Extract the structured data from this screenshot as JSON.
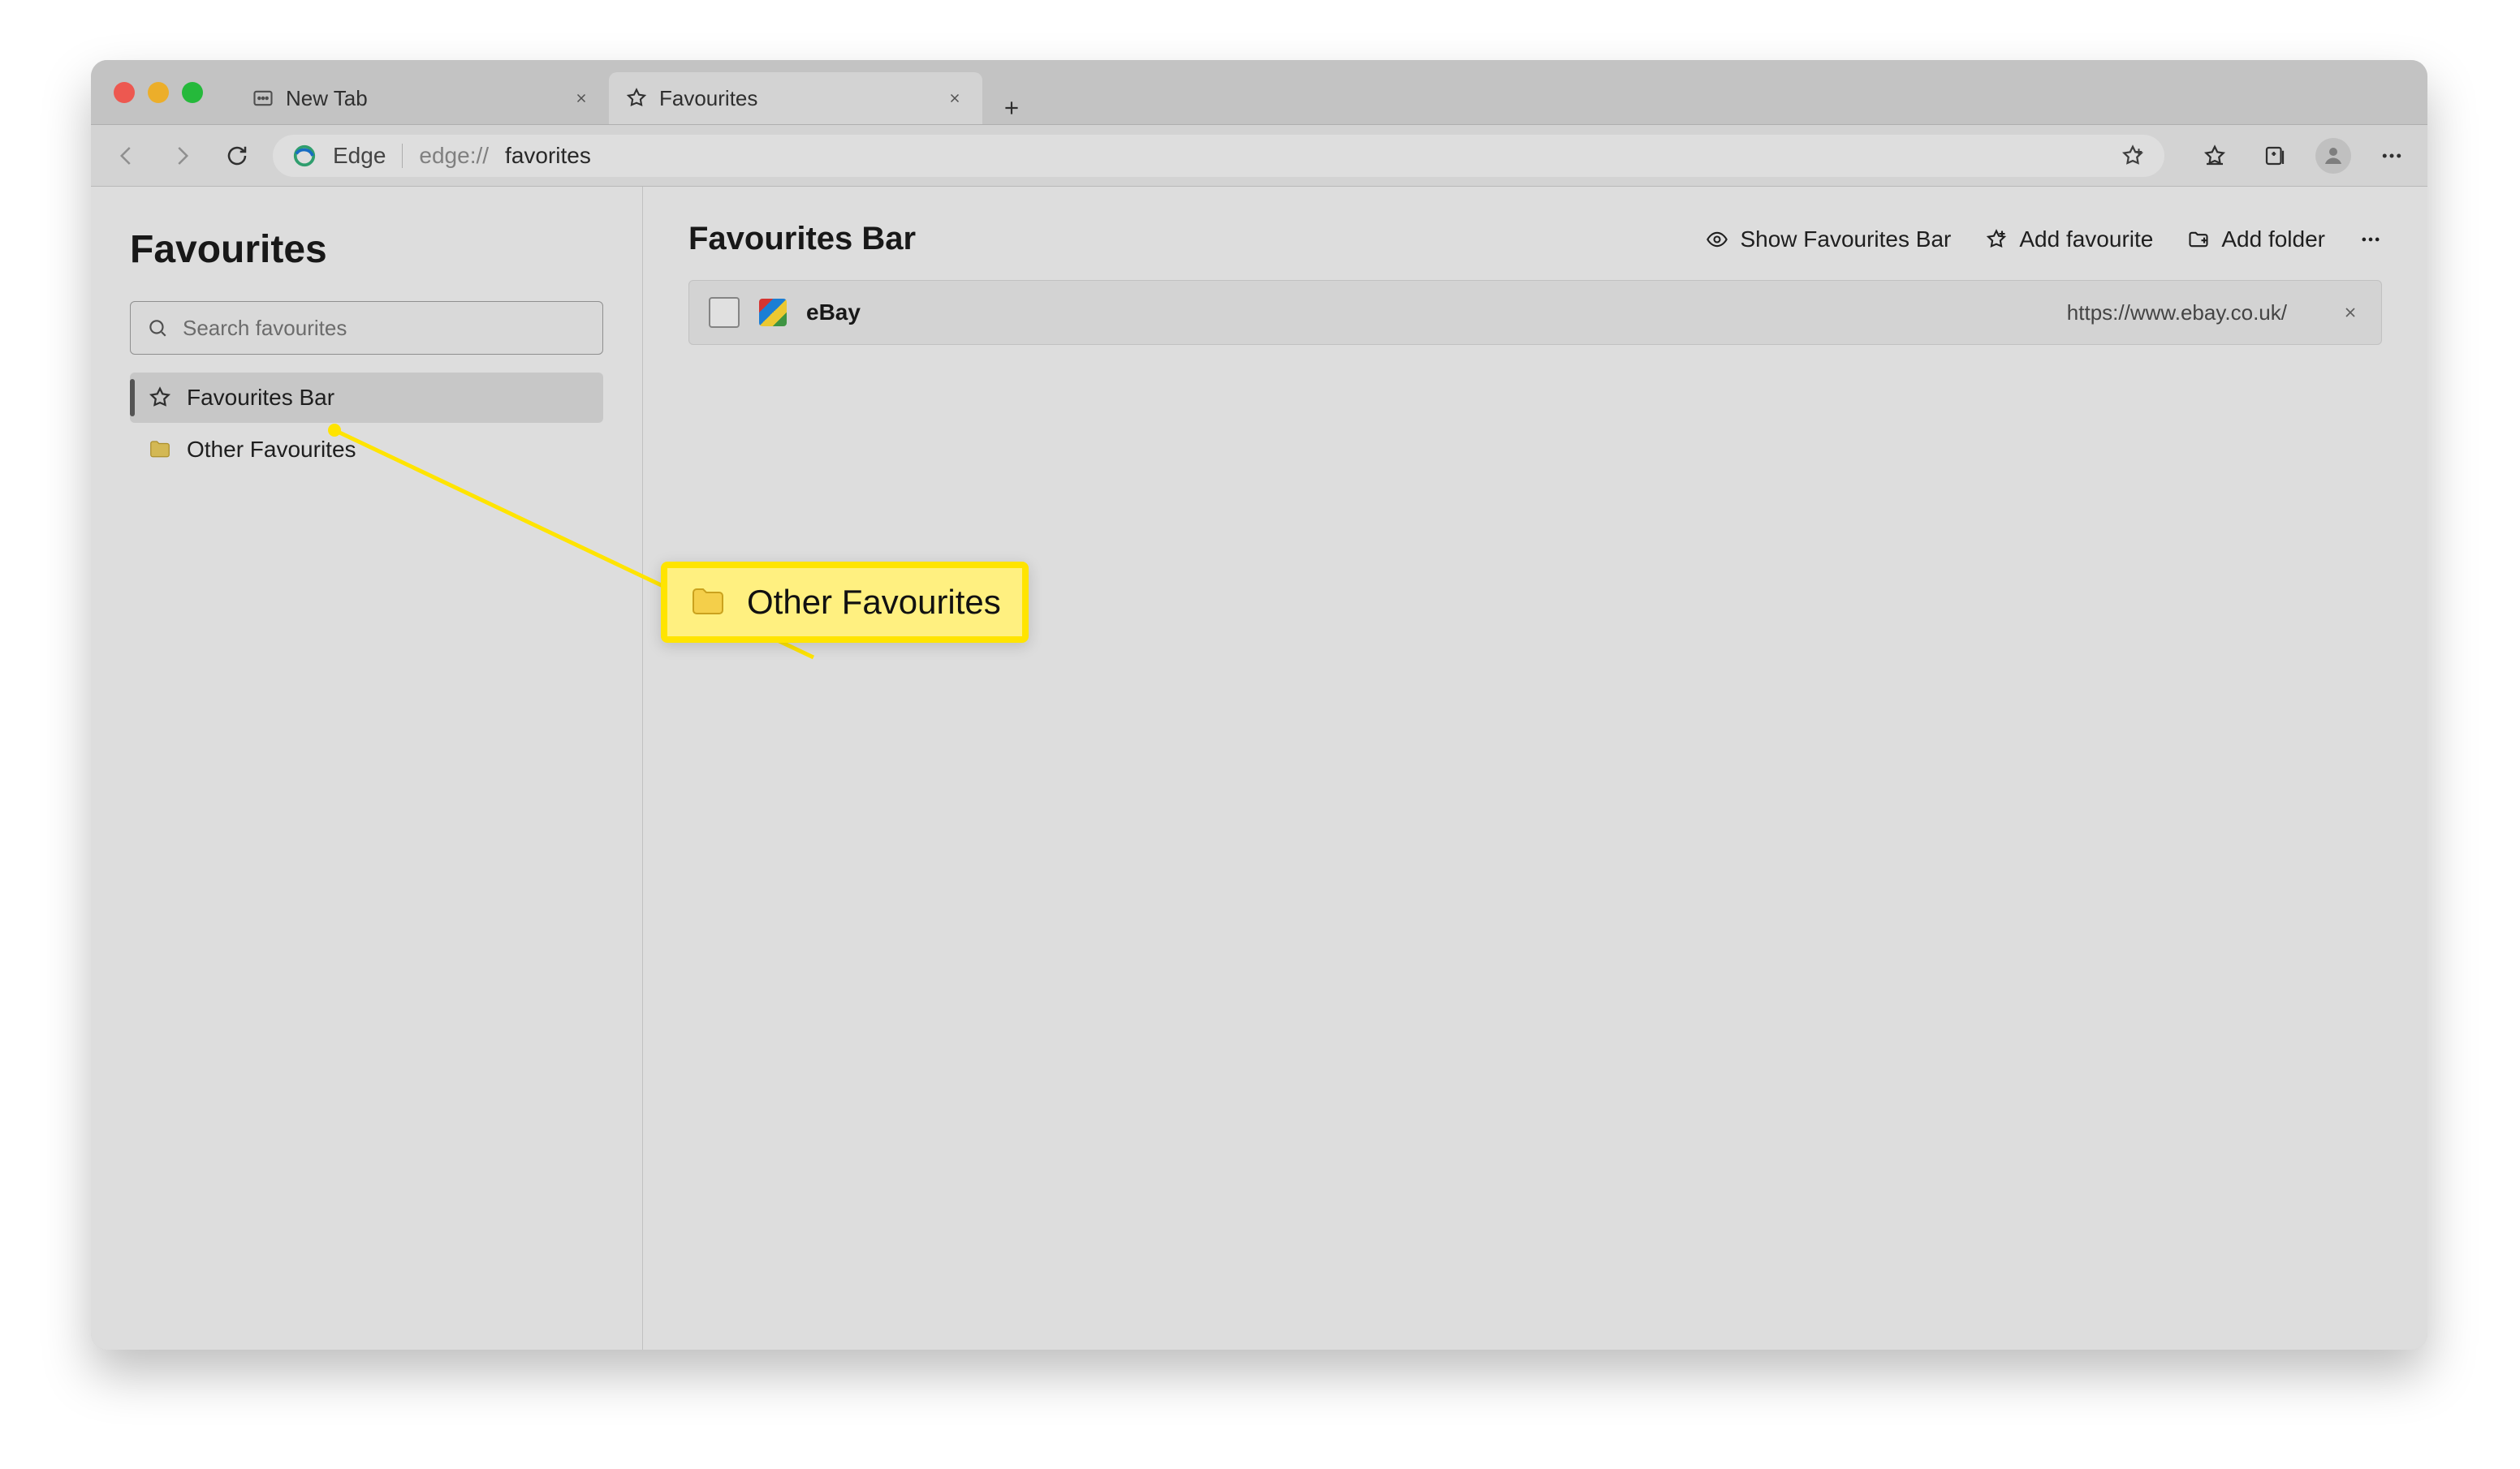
{
  "window": {
    "tabs": [
      {
        "label": "New Tab",
        "active": false
      },
      {
        "label": "Favourites",
        "active": true
      }
    ]
  },
  "toolbar": {
    "brand": "Edge",
    "url_prefix": "edge://",
    "url_page": "favorites"
  },
  "sidebar": {
    "title": "Favourites",
    "search_placeholder": "Search favourites",
    "items": [
      {
        "label": "Favourites Bar",
        "icon": "star",
        "selected": true
      },
      {
        "label": "Other Favourites",
        "icon": "folder",
        "selected": false
      }
    ]
  },
  "main": {
    "title": "Favourites Bar",
    "actions": {
      "show_bar": "Show Favourites Bar",
      "add_fav": "Add favourite",
      "add_folder": "Add folder"
    },
    "rows": [
      {
        "name": "eBay",
        "url": "https://www.ebay.co.uk/"
      }
    ]
  },
  "callout": {
    "label": "Other Favourites"
  }
}
